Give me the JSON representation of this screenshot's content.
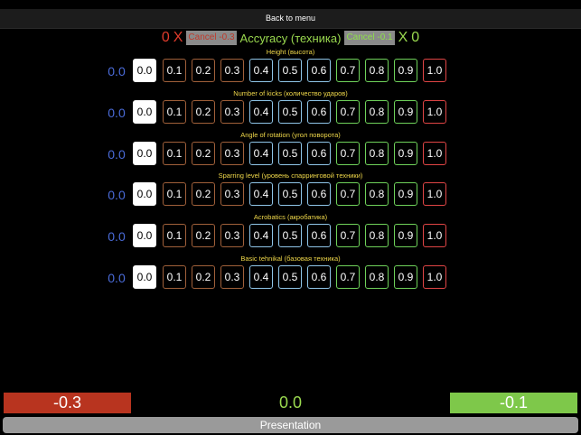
{
  "nav": {
    "back_label": "Back to menu"
  },
  "header": {
    "left_count": "0",
    "left_x": "X",
    "cancel_neg": "Cancel -0.3",
    "title": "Accyracy (техника)",
    "cancel_pos": "Cancel -0.1",
    "right_x": "X",
    "right_count": "0"
  },
  "criteria": [
    {
      "label": "Height (высота)",
      "value": "0.0"
    },
    {
      "label": "Number of kicks (количество ударов)",
      "value": "0.0"
    },
    {
      "label": "Angle of rotation (угол поворота)",
      "value": "0.0"
    },
    {
      "label": "Sparring level (уровень спарринговой техники)",
      "value": "0.0"
    },
    {
      "label": "Acrobatics (акробатика)",
      "value": "0.0"
    },
    {
      "label": "Basic tehnikal (базовая техника)",
      "value": "0.0"
    }
  ],
  "scale": [
    "0.0",
    "0.1",
    "0.2",
    "0.3",
    "0.4",
    "0.5",
    "0.6",
    "0.7",
    "0.8",
    "0.9",
    "1.0"
  ],
  "selected_index": 0,
  "footer": {
    "minus_value": "-0.3",
    "total_value": "0.0",
    "plus_value": "-0.1",
    "presentation_label": "Presentation"
  },
  "colors": {
    "brown": "#a0603a",
    "blue": "#8fc5e8",
    "green": "#6fd25a",
    "red": "#e04545",
    "label_yellow": "#f0d84a",
    "value_blue": "#4a6bd8"
  }
}
